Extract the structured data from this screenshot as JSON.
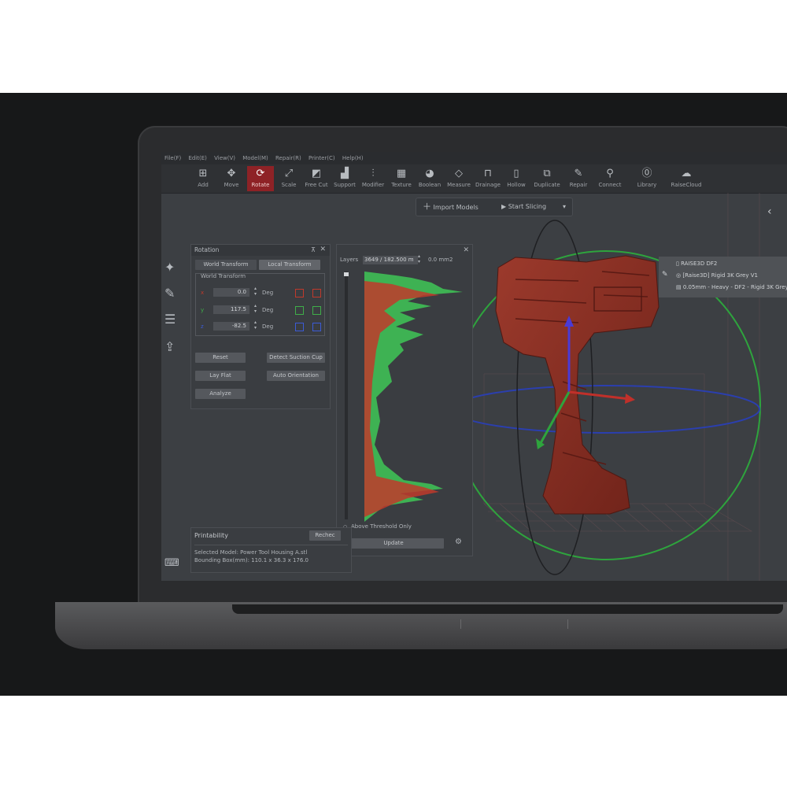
{
  "menu": {
    "items": [
      "File(F)",
      "Edit(E)",
      "View(V)",
      "Model(M)",
      "Repair(R)",
      "Printer(C)",
      "Help(H)"
    ]
  },
  "toolbar": {
    "tools": [
      {
        "label": "Add",
        "icon": "add-model-icon"
      },
      {
        "label": "Move",
        "icon": "move-icon"
      },
      {
        "label": "Rotate",
        "icon": "rotate-icon",
        "active": true
      },
      {
        "label": "Scale",
        "icon": "scale-icon"
      },
      {
        "label": "Free Cut",
        "icon": "free-cut-icon"
      },
      {
        "label": "Support",
        "icon": "support-icon"
      },
      {
        "label": "Modifier",
        "icon": "modifier-icon"
      },
      {
        "label": "Texture",
        "icon": "texture-icon"
      },
      {
        "label": "Boolean",
        "icon": "boolean-icon"
      },
      {
        "label": "Measure",
        "icon": "measure-icon"
      },
      {
        "label": "Drainage",
        "icon": "drainage-icon"
      },
      {
        "label": "Hollow",
        "icon": "hollow-icon"
      },
      {
        "label": "Duplicate",
        "icon": "duplicate-icon"
      },
      {
        "label": "Repair",
        "icon": "repair-icon"
      },
      {
        "label": "Connect",
        "icon": "connect-icon"
      },
      {
        "label": "Library",
        "icon": "library-icon"
      },
      {
        "label": "RaiseCloud",
        "icon": "cloud-icon"
      }
    ]
  },
  "actions": {
    "import_models": "Import Models",
    "start_slicing": "Start Slicing"
  },
  "rotation": {
    "title": "Rotation",
    "tab_world": "World Transform",
    "tab_local": "Local Transform",
    "group_label": "World Transform",
    "x": {
      "value": "0.0",
      "unit": "Deg",
      "color": "#c0392b"
    },
    "y": {
      "value": "117.5",
      "unit": "Deg",
      "color": "#3fae49"
    },
    "z": {
      "value": "-82.5",
      "unit": "Deg",
      "color": "#3b5bd6"
    },
    "buttons": {
      "reset": "Reset",
      "detect_suction_cup": "Detect Suction Cup",
      "lay_flat": "Lay Flat",
      "auto_orientation": "Auto Orientation",
      "analyze": "Analyze"
    }
  },
  "layers": {
    "label": "Layers",
    "value": "3649 / 182.500 m",
    "area": "0.0 mm2",
    "above_threshold": "Above Threshold Only",
    "update": "Update"
  },
  "printability": {
    "title": "Printability",
    "recheck": "Rechec",
    "selected_model": "Selected Model: Power Tool Housing A.stl",
    "bounding_box": "Bounding Box(mm): 110.1 x 36.3 x 176.0"
  },
  "printer_info": {
    "printer": "RAISE3D DF2",
    "material": "[Raise3D] Rigid 3K Grey V1",
    "profile": "0.05mm - Heavy - DF2 - Rigid 3K Grey"
  },
  "colors": {
    "accent": "#8e2226",
    "model": "#8a2e24",
    "histogram_green": "#3fbf55",
    "histogram_red": "#c0392b"
  }
}
